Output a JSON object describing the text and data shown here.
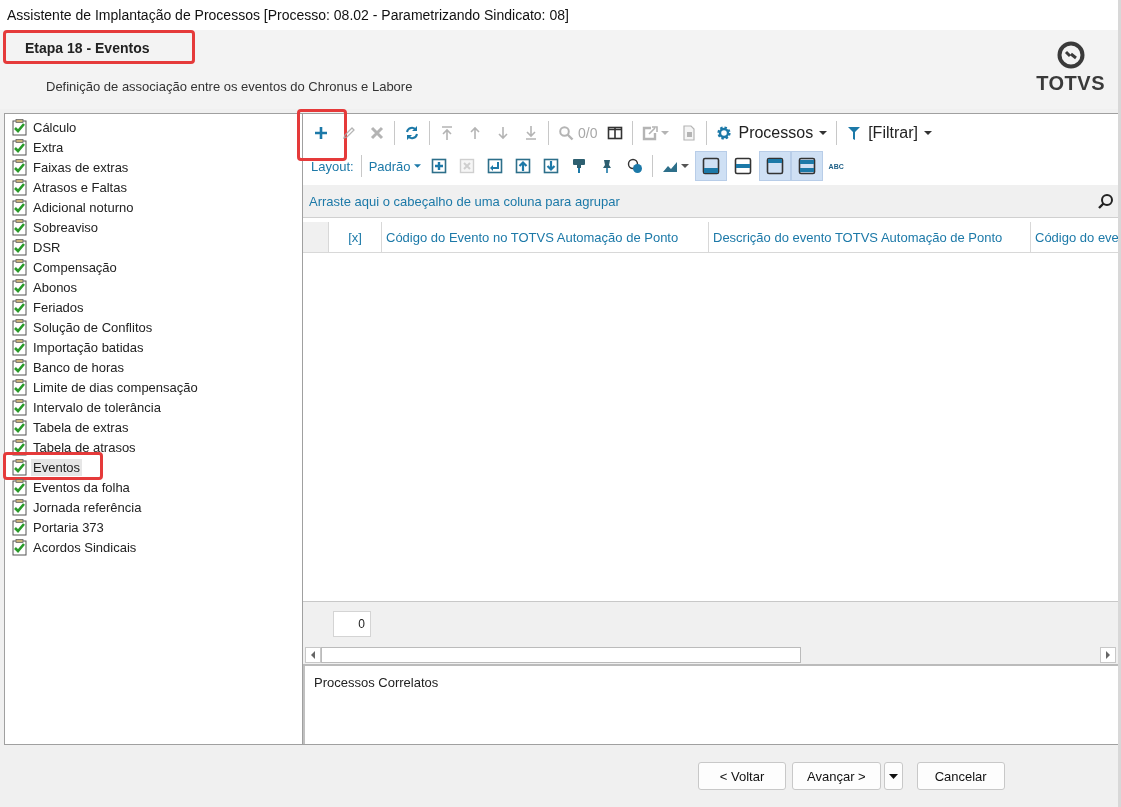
{
  "window": {
    "title": "Assistente de Implantação de Processos [Processo: 08.02 - Parametrizando Sindicato: 08]"
  },
  "header": {
    "step": "Etapa 18 - Eventos",
    "highlighted": true,
    "description": "Definição de associação entre os eventos do Chronus e Labore",
    "logo_text": "TOTVS"
  },
  "steps": [
    {
      "label": "Cálculo",
      "done": true,
      "selected": false,
      "highlighted": false
    },
    {
      "label": "Extra",
      "done": true,
      "selected": false,
      "highlighted": false
    },
    {
      "label": "Faixas de extras",
      "done": true,
      "selected": false,
      "highlighted": false
    },
    {
      "label": "Atrasos e Faltas",
      "done": true,
      "selected": false,
      "highlighted": false
    },
    {
      "label": "Adicional noturno",
      "done": true,
      "selected": false,
      "highlighted": false
    },
    {
      "label": "Sobreaviso",
      "done": true,
      "selected": false,
      "highlighted": false
    },
    {
      "label": "DSR",
      "done": true,
      "selected": false,
      "highlighted": false
    },
    {
      "label": "Compensação",
      "done": true,
      "selected": false,
      "highlighted": false
    },
    {
      "label": "Abonos",
      "done": true,
      "selected": false,
      "highlighted": false
    },
    {
      "label": "Feriados",
      "done": true,
      "selected": false,
      "highlighted": false
    },
    {
      "label": "Solução de Conflitos",
      "done": true,
      "selected": false,
      "highlighted": false
    },
    {
      "label": "Importação batidas",
      "done": true,
      "selected": false,
      "highlighted": false
    },
    {
      "label": "Banco de horas",
      "done": true,
      "selected": false,
      "highlighted": false
    },
    {
      "label": "Limite de dias compensação",
      "done": true,
      "selected": false,
      "highlighted": false
    },
    {
      "label": "Intervalo de tolerância",
      "done": true,
      "selected": false,
      "highlighted": false
    },
    {
      "label": "Tabela de extras",
      "done": true,
      "selected": false,
      "highlighted": false
    },
    {
      "label": "Tabela de atrasos",
      "done": true,
      "selected": false,
      "highlighted": false
    },
    {
      "label": "Eventos",
      "done": true,
      "selected": true,
      "highlighted": true
    },
    {
      "label": "Eventos da folha",
      "done": true,
      "selected": false,
      "highlighted": false
    },
    {
      "label": "Jornada referência",
      "done": true,
      "selected": false,
      "highlighted": false
    },
    {
      "label": "Portaria 373",
      "done": true,
      "selected": false,
      "highlighted": false
    },
    {
      "label": "Acordos Sindicais",
      "done": true,
      "selected": false,
      "highlighted": false
    }
  ],
  "toolbar": [
    {
      "kind": "icon",
      "disabled": false,
      "highlighted": true
    },
    {
      "kind": "icon",
      "disabled": true,
      "highlighted": false
    },
    {
      "kind": "icon",
      "disabled": true,
      "highlighted": false
    },
    {
      "kind": "separator"
    },
    {
      "kind": "icon",
      "disabled": false,
      "highlighted": false
    },
    {
      "kind": "separator"
    },
    {
      "kind": "icon",
      "disabled": true,
      "highlighted": false
    },
    {
      "kind": "icon",
      "disabled": true,
      "highlighted": false
    },
    {
      "kind": "icon",
      "disabled": true,
      "highlighted": false
    },
    {
      "kind": "icon",
      "disabled": true,
      "highlighted": false
    },
    {
      "kind": "separator"
    },
    {
      "kind": "icon",
      "disabled": true,
      "highlighted": false
    },
    {
      "kind": "text",
      "text": "0/0",
      "disabled": true
    },
    {
      "kind": "icon",
      "disabled": false,
      "highlighted": false
    },
    {
      "kind": "separator"
    },
    {
      "kind": "icon",
      "disabled": true,
      "highlighted": false,
      "dropdown": true
    },
    {
      "kind": "icon",
      "disabled": true,
      "highlighted": false
    },
    {
      "kind": "separator"
    },
    {
      "kind": "menu",
      "label": "Processos"
    },
    {
      "kind": "separator"
    },
    {
      "kind": "menu",
      "label": "[Filtrar]"
    }
  ],
  "layout_bar": [
    {
      "kind": "label",
      "text": "Layout:"
    },
    {
      "kind": "separator"
    },
    {
      "kind": "dropdown",
      "label": "Padrão"
    },
    {
      "kind": "icon",
      "disabled": false
    },
    {
      "kind": "icon",
      "disabled": true
    },
    {
      "kind": "icon",
      "disabled": false
    },
    {
      "kind": "icon",
      "disabled": false
    },
    {
      "kind": "icon",
      "disabled": false
    },
    {
      "kind": "icon",
      "disabled": false
    },
    {
      "kind": "icon",
      "disabled": false
    },
    {
      "kind": "icon",
      "disabled": false
    },
    {
      "kind": "separator"
    },
    {
      "kind": "icon",
      "disabled": false,
      "dropdown": true
    },
    {
      "kind": "toggle",
      "pressed": true
    },
    {
      "kind": "toggle",
      "pressed": false
    },
    {
      "kind": "toggle",
      "pressed": true
    },
    {
      "kind": "toggle",
      "pressed": true
    },
    {
      "kind": "tiny",
      "text": "ABC"
    }
  ],
  "group_panel": {
    "hint": "Arraste aqui o cabeçalho de uma coluna para agrupar"
  },
  "grid": {
    "columns": [
      "[x]",
      "Código do Evento no TOTVS Automação de Ponto",
      "Descrição do evento TOTVS Automação de Ponto",
      "Código do eve"
    ],
    "count": "0"
  },
  "related": {
    "title": "Processos Correlatos"
  },
  "buttons": [
    {
      "kind": "text",
      "label": "< Voltar"
    },
    {
      "kind": "text",
      "label": "Avançar >"
    },
    {
      "kind": "caret"
    },
    {
      "kind": "text",
      "label": "Cancelar"
    }
  ]
}
